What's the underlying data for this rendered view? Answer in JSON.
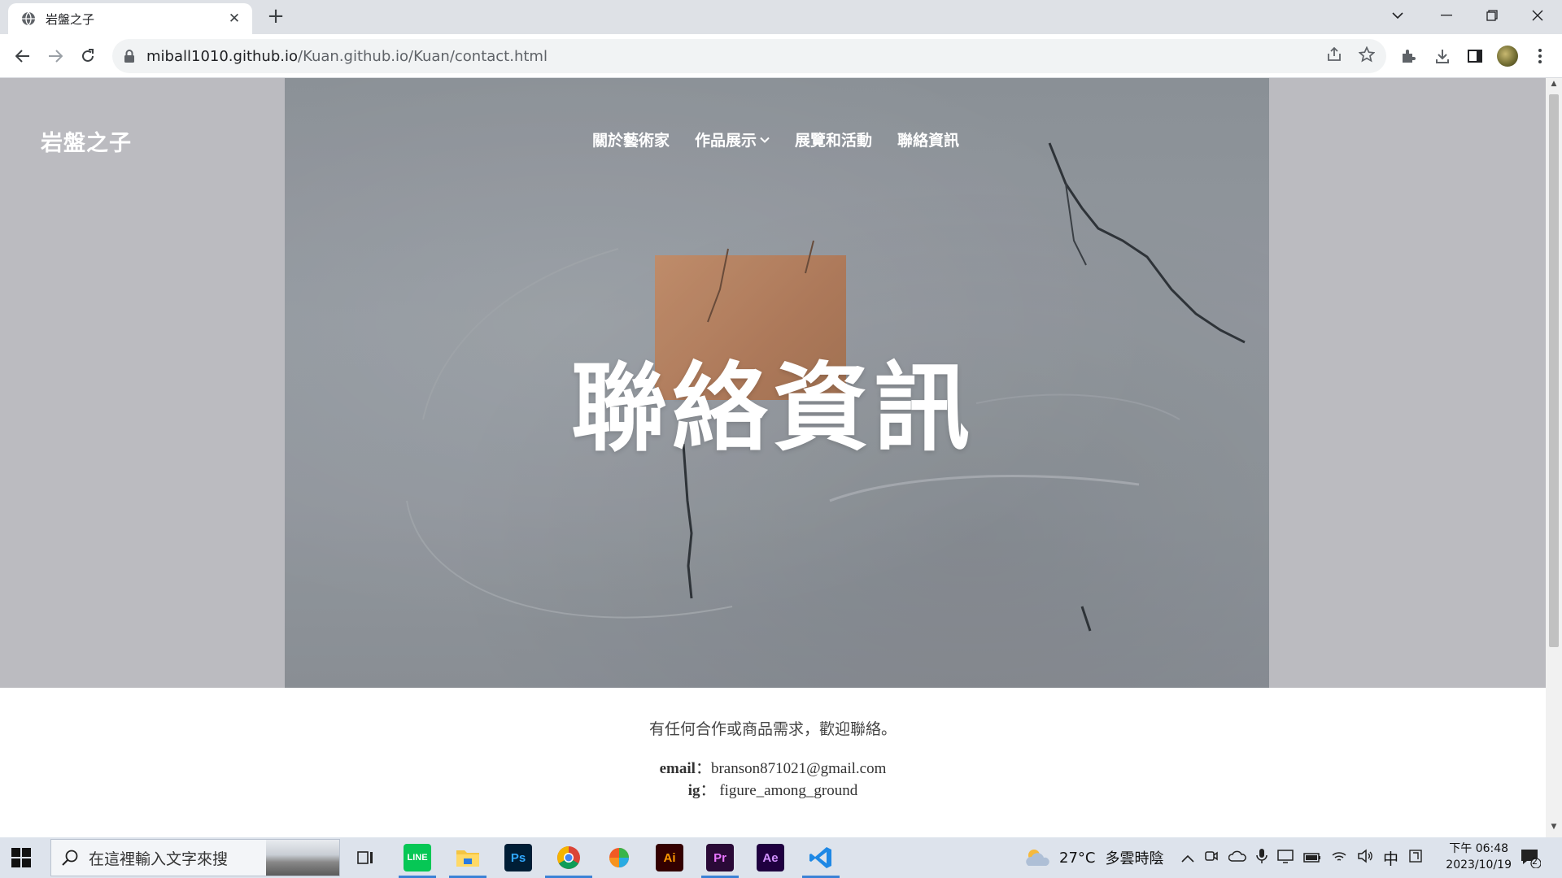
{
  "browser": {
    "tab_title": "岩盤之子",
    "url_domain": "miball1010.github.io",
    "url_path": "/Kuan.github.io/Kuan/contact.html"
  },
  "site": {
    "brand": "岩盤之子",
    "nav": [
      {
        "label": "關於藝術家"
      },
      {
        "label": "作品展示"
      },
      {
        "label": "展覽和活動"
      },
      {
        "label": "聯絡資訊"
      }
    ],
    "hero_title": "聯絡資訊"
  },
  "contact": {
    "intro": "有任何合作或商品需求，歡迎聯絡。",
    "email_label": "email",
    "email_sep": "：",
    "email_value": "branson871021@gmail.com",
    "ig_label": "ig",
    "ig_sep": "：",
    "ig_value": "figure_among_ground"
  },
  "taskbar": {
    "search_placeholder": "在這裡輸入文字來搜",
    "weather_temp": "27°C",
    "weather_text": "多雲時陰",
    "ime": "中",
    "time": "下午 06:48",
    "date": "2023/10/19",
    "notification_count": "2",
    "apps": [
      "LINE",
      "Files",
      "Ps",
      "Chrome",
      "Paint",
      "Ai",
      "Pr",
      "Ae",
      "VS Code"
    ]
  }
}
